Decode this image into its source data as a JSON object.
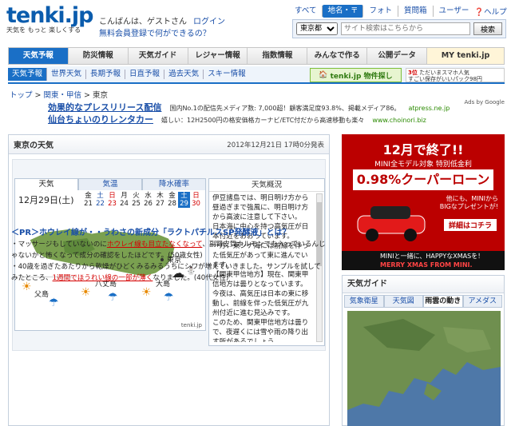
{
  "header": {
    "logo_text": "tenki.jp",
    "tagline": "天気を もっと 楽しくする",
    "greeting": "こんばんは、ゲストさん",
    "login": "ログイン",
    "register_link": "無料会員登録で何ができるの？",
    "help": "ヘルプ"
  },
  "topnav": {
    "items": [
      "すべて",
      "地名・〒",
      "フォト",
      "質問箱",
      "ユーザー"
    ],
    "selected": "地名・〒"
  },
  "search": {
    "region": "東京都",
    "placeholder": "サイト検索はこちらから",
    "button": "検索"
  },
  "mainnav": {
    "items": [
      "天気予報",
      "防災情報",
      "天気ガイド",
      "レジャー情報",
      "指数情報",
      "みんなで作る",
      "公開データ",
      "MY tenki.jp"
    ],
    "selected": "天気予報"
  },
  "subnav": {
    "items": [
      "天気予報",
      "世界天気",
      "長期予報",
      "日直予報",
      "過去天気",
      "スキー情報"
    ],
    "selected": "天気予報"
  },
  "banners": {
    "b1": "tenki.jp 物件探し",
    "b2_line1": "3位",
    "b2_line2": "ただいまスマホ人気",
    "b2_line3": "すごい保存がいいパック98円"
  },
  "breadcrumb": {
    "items": [
      "トップ",
      "関東・甲信",
      "東京"
    ],
    "separator": " > "
  },
  "ads": {
    "label": "Ads by Google",
    "items": [
      {
        "title": "効果的なプレスリリース配信",
        "desc": "国内No.1の配信先メディア数: 7,000超！顧客満足度93.8%、掲載メディア86。",
        "url": "atpress.ne.jp"
      },
      {
        "title": "仙台ちょいのりレンタカー",
        "desc": "嬉しい：12H2500円の格安価格カーナビ/ETC付だから高速移動も楽々",
        "url": "www.choinori.biz"
      }
    ]
  },
  "weather_panel": {
    "title": "東京の天気",
    "issued": "2012年12月21日 17時0分発表",
    "tabs": [
      "天気",
      "気温",
      "降水確率"
    ],
    "selected_tab": "天気",
    "map_date": "12月29日(土)",
    "days": [
      {
        "w": "金",
        "d": "21"
      },
      {
        "w": "土",
        "d": "22"
      },
      {
        "w": "日",
        "d": "23"
      },
      {
        "w": "月",
        "d": "24"
      },
      {
        "w": "火",
        "d": "25"
      },
      {
        "w": "水",
        "d": "26"
      },
      {
        "w": "木",
        "d": "27"
      },
      {
        "w": "金",
        "d": "28"
      },
      {
        "w": "土",
        "d": "29"
      },
      {
        "w": "日",
        "d": "30"
      }
    ],
    "map_labels": {
      "tokyo": "東京",
      "chichijima": "父島",
      "hachijojima": "八丈島",
      "oshima": "大島",
      "credit": "tenki.jp"
    },
    "overview_title": "天気概況",
    "overview_text": "伊豆諸島では、明日明け方から昼過ぎまで強風に、明日明け方から高波に注意して下さい。\n日本海に中心を持つ高気圧が日本付近をおおっています。\n一方、東シナ海には前線を伴った低気圧があって東に進んでいます。\n【関東甲信地方】現在、関東甲信地方は曇りとなっています。\n今夜は、高気圧は日本の東に移動し、前線を伴った低気圧が九州付近に進む見込みです。\nこのため、関東甲信地方は曇りで、夜遅くには雪や雨の降り出す所があるでしょう。"
  },
  "pr": {
    "title": "＜PR＞ホウレイ線が・・うわさの新成分「ラクトパチルスSP発酵液」とは？",
    "line1_a": "・マッサージもしていないのに",
    "line1_u": "ホウレイ線も目立たなくなって",
    "line1_b": "、副腎皮質ホルモンでも入っているんじゃないかと怖くなって成分の確認をしたほどです。(50歳女性)",
    "line2_a": "・40歳を過ぎたあたりから乾燥がひどくみるみるうちにシワが増えていきました。サンプルを試してみたところ、",
    "line2_u": "1週間でほうれい線の一部が薄く",
    "line2_b": "なりました。(40代女性)"
  },
  "ad_right": {
    "headline": "12月で終了!!",
    "sub": "MINI全モデル対象 特別低金利",
    "rate": "0.98%クーパーローン",
    "note1": "他にも、MINIから",
    "note2": "BIGなプレゼントが!",
    "cta": "詳細はコチラ",
    "footer1": "MINIと一緒に、HAPPYなXMASを！",
    "footer2": "MERRY XMAS FROM MINI."
  },
  "guide": {
    "title": "天気ガイド",
    "tabs": [
      "気象衛星",
      "天気図",
      "雨雲の動き",
      "アメダス"
    ],
    "selected_tab": "雨雲の動き"
  }
}
